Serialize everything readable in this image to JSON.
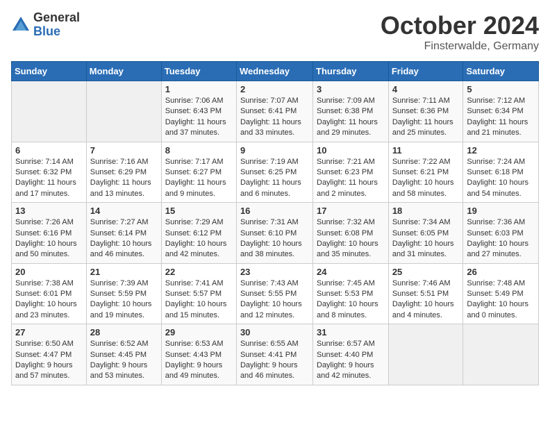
{
  "logo": {
    "general": "General",
    "blue": "Blue"
  },
  "title": "October 2024",
  "subtitle": "Finsterwalde, Germany",
  "days_header": [
    "Sunday",
    "Monday",
    "Tuesday",
    "Wednesday",
    "Thursday",
    "Friday",
    "Saturday"
  ],
  "weeks": [
    [
      {
        "day": "",
        "sunrise": "",
        "sunset": "",
        "daylight": ""
      },
      {
        "day": "",
        "sunrise": "",
        "sunset": "",
        "daylight": ""
      },
      {
        "day": "1",
        "sunrise": "Sunrise: 7:06 AM",
        "sunset": "Sunset: 6:43 PM",
        "daylight": "Daylight: 11 hours and 37 minutes."
      },
      {
        "day": "2",
        "sunrise": "Sunrise: 7:07 AM",
        "sunset": "Sunset: 6:41 PM",
        "daylight": "Daylight: 11 hours and 33 minutes."
      },
      {
        "day": "3",
        "sunrise": "Sunrise: 7:09 AM",
        "sunset": "Sunset: 6:38 PM",
        "daylight": "Daylight: 11 hours and 29 minutes."
      },
      {
        "day": "4",
        "sunrise": "Sunrise: 7:11 AM",
        "sunset": "Sunset: 6:36 PM",
        "daylight": "Daylight: 11 hours and 25 minutes."
      },
      {
        "day": "5",
        "sunrise": "Sunrise: 7:12 AM",
        "sunset": "Sunset: 6:34 PM",
        "daylight": "Daylight: 11 hours and 21 minutes."
      }
    ],
    [
      {
        "day": "6",
        "sunrise": "Sunrise: 7:14 AM",
        "sunset": "Sunset: 6:32 PM",
        "daylight": "Daylight: 11 hours and 17 minutes."
      },
      {
        "day": "7",
        "sunrise": "Sunrise: 7:16 AM",
        "sunset": "Sunset: 6:29 PM",
        "daylight": "Daylight: 11 hours and 13 minutes."
      },
      {
        "day": "8",
        "sunrise": "Sunrise: 7:17 AM",
        "sunset": "Sunset: 6:27 PM",
        "daylight": "Daylight: 11 hours and 9 minutes."
      },
      {
        "day": "9",
        "sunrise": "Sunrise: 7:19 AM",
        "sunset": "Sunset: 6:25 PM",
        "daylight": "Daylight: 11 hours and 6 minutes."
      },
      {
        "day": "10",
        "sunrise": "Sunrise: 7:21 AM",
        "sunset": "Sunset: 6:23 PM",
        "daylight": "Daylight: 11 hours and 2 minutes."
      },
      {
        "day": "11",
        "sunrise": "Sunrise: 7:22 AM",
        "sunset": "Sunset: 6:21 PM",
        "daylight": "Daylight: 10 hours and 58 minutes."
      },
      {
        "day": "12",
        "sunrise": "Sunrise: 7:24 AM",
        "sunset": "Sunset: 6:18 PM",
        "daylight": "Daylight: 10 hours and 54 minutes."
      }
    ],
    [
      {
        "day": "13",
        "sunrise": "Sunrise: 7:26 AM",
        "sunset": "Sunset: 6:16 PM",
        "daylight": "Daylight: 10 hours and 50 minutes."
      },
      {
        "day": "14",
        "sunrise": "Sunrise: 7:27 AM",
        "sunset": "Sunset: 6:14 PM",
        "daylight": "Daylight: 10 hours and 46 minutes."
      },
      {
        "day": "15",
        "sunrise": "Sunrise: 7:29 AM",
        "sunset": "Sunset: 6:12 PM",
        "daylight": "Daylight: 10 hours and 42 minutes."
      },
      {
        "day": "16",
        "sunrise": "Sunrise: 7:31 AM",
        "sunset": "Sunset: 6:10 PM",
        "daylight": "Daylight: 10 hours and 38 minutes."
      },
      {
        "day": "17",
        "sunrise": "Sunrise: 7:32 AM",
        "sunset": "Sunset: 6:08 PM",
        "daylight": "Daylight: 10 hours and 35 minutes."
      },
      {
        "day": "18",
        "sunrise": "Sunrise: 7:34 AM",
        "sunset": "Sunset: 6:05 PM",
        "daylight": "Daylight: 10 hours and 31 minutes."
      },
      {
        "day": "19",
        "sunrise": "Sunrise: 7:36 AM",
        "sunset": "Sunset: 6:03 PM",
        "daylight": "Daylight: 10 hours and 27 minutes."
      }
    ],
    [
      {
        "day": "20",
        "sunrise": "Sunrise: 7:38 AM",
        "sunset": "Sunset: 6:01 PM",
        "daylight": "Daylight: 10 hours and 23 minutes."
      },
      {
        "day": "21",
        "sunrise": "Sunrise: 7:39 AM",
        "sunset": "Sunset: 5:59 PM",
        "daylight": "Daylight: 10 hours and 19 minutes."
      },
      {
        "day": "22",
        "sunrise": "Sunrise: 7:41 AM",
        "sunset": "Sunset: 5:57 PM",
        "daylight": "Daylight: 10 hours and 15 minutes."
      },
      {
        "day": "23",
        "sunrise": "Sunrise: 7:43 AM",
        "sunset": "Sunset: 5:55 PM",
        "daylight": "Daylight: 10 hours and 12 minutes."
      },
      {
        "day": "24",
        "sunrise": "Sunrise: 7:45 AM",
        "sunset": "Sunset: 5:53 PM",
        "daylight": "Daylight: 10 hours and 8 minutes."
      },
      {
        "day": "25",
        "sunrise": "Sunrise: 7:46 AM",
        "sunset": "Sunset: 5:51 PM",
        "daylight": "Daylight: 10 hours and 4 minutes."
      },
      {
        "day": "26",
        "sunrise": "Sunrise: 7:48 AM",
        "sunset": "Sunset: 5:49 PM",
        "daylight": "Daylight: 10 hours and 0 minutes."
      }
    ],
    [
      {
        "day": "27",
        "sunrise": "Sunrise: 6:50 AM",
        "sunset": "Sunset: 4:47 PM",
        "daylight": "Daylight: 9 hours and 57 minutes."
      },
      {
        "day": "28",
        "sunrise": "Sunrise: 6:52 AM",
        "sunset": "Sunset: 4:45 PM",
        "daylight": "Daylight: 9 hours and 53 minutes."
      },
      {
        "day": "29",
        "sunrise": "Sunrise: 6:53 AM",
        "sunset": "Sunset: 4:43 PM",
        "daylight": "Daylight: 9 hours and 49 minutes."
      },
      {
        "day": "30",
        "sunrise": "Sunrise: 6:55 AM",
        "sunset": "Sunset: 4:41 PM",
        "daylight": "Daylight: 9 hours and 46 minutes."
      },
      {
        "day": "31",
        "sunrise": "Sunrise: 6:57 AM",
        "sunset": "Sunset: 4:40 PM",
        "daylight": "Daylight: 9 hours and 42 minutes."
      },
      {
        "day": "",
        "sunrise": "",
        "sunset": "",
        "daylight": ""
      },
      {
        "day": "",
        "sunrise": "",
        "sunset": "",
        "daylight": ""
      }
    ]
  ]
}
